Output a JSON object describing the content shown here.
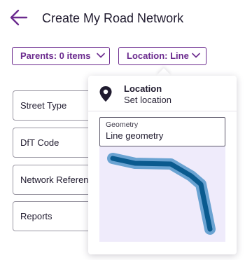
{
  "header": {
    "title": "Create My Road Network",
    "back_icon": "arrow-left-icon"
  },
  "filters": {
    "parents_label": "Parents: 0 items",
    "location_label": "Location: Line"
  },
  "fields": [
    {
      "label": "Street Type"
    },
    {
      "label": "DfT Code"
    },
    {
      "label": "Network Reference"
    },
    {
      "label": "Reports"
    }
  ],
  "popover": {
    "title": "Location",
    "subtitle": "Set location",
    "icon": "map-pin-icon",
    "geometry_label": "Geometry",
    "geometry_value": "Line geometry"
  },
  "colors": {
    "accent": "#6b2a8e",
    "map_background": "#efebfb",
    "line_outer": "#6aa3d2",
    "line_inner": "#0a5a8f"
  }
}
